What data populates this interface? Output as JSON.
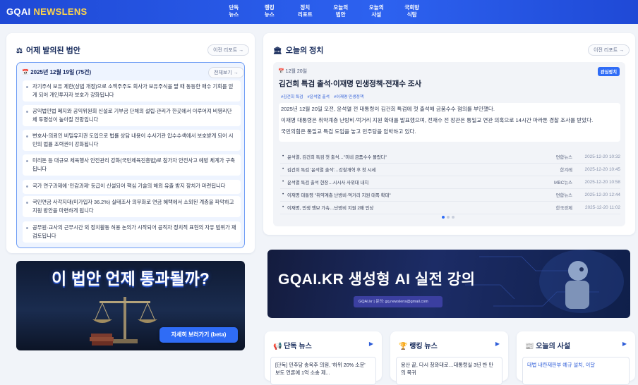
{
  "brand": {
    "part1": "GQAI",
    "part2": "NEWSLENS"
  },
  "nav": [
    {
      "label": "단독\n뉴스"
    },
    {
      "label": "랭킹\n뉴스"
    },
    {
      "label": "정치\n리포트"
    },
    {
      "label": "오늘의\n법안"
    },
    {
      "label": "오늘의\n사설"
    },
    {
      "label": "국회방\n식탐"
    }
  ],
  "law_section": {
    "title": "어제 발의된 법안",
    "prev_report": "이전 리포트 →",
    "date": "2025년 12월 19일 (75건)",
    "view_all": "전체보기 →",
    "items": [
      "자기주식 보유 제한(상법 개정)으로 소액주주도 회사가 보유주식을 팔 때 동등한 매수 기회를 얻게 되어 개인투자자 보호가 강화됩니다",
      "공익법인법 폐지와 공익위원회 신설로 기부금 단체의 설립·관리가 한곳에서 이루어져 비영리단체 투명성이 높아질 전망입니다",
      "변호사-의뢰인 비밀유지권 도입으로 법률 상담 내용이 수사기관 압수수색에서 보호받게 되어 시민의 법률 조력권이 강화됩니다",
      "미리돈 등 대규모 체육행사 안전관리 강화(국민체육진흥법)로 참가자 안전사고 예방 체계가 구축됩니다",
      "국가 연구과제에 '민감과제' 등급이 신설되어 핵심 기술의 해외 유출 방지 장치가 마련됩니다",
      "국민연금 사각지대(미가입자 36.2%) 실태조사 의무화로 연금 혜택에서 소외된 계층을 파악하고 지원 방안을 마련하게 됩니다",
      "공무원·교사의 근무시간 외 정치활동 허용 논의가 시작되어 공직자 정치적 표현의 자유 범위가 재검토됩니다"
    ]
  },
  "banner_law": {
    "title": "이 법안 언제 통과될까?",
    "cta": "자세히 보러가기 (beta)"
  },
  "politics": {
    "title": "오늘의 정치",
    "prev_report": "이전 리포트 →",
    "date": "12월 20일",
    "badge": "관심정치",
    "headline": "김건희 특검 출석·이재명 민생정책·전재수 조사",
    "tags": [
      "#김건희 특검",
      "#윤석열 출석",
      "#이재명 민생정책"
    ],
    "body": [
      "2025년 12월 20일 오전, 윤석열 전 대통령이 김건희 특검에 첫 출석해 금품수수 혐의를 부인했다.",
      "이재명 대통령은 취약계층 난방비·먹거리 지원 확대를 발표했으며, 전재수 전 장관은 통일교 연관 의혹으로 14시간 마라톤 경찰 조사를 받았다.",
      "국민의힘은 통일교 특검 도입을 놓고 민주당을 압박하고 있다."
    ],
    "news": [
      {
        "title": "윤석열, 김건희 특검 첫 출석…\"미네 금품수수 몰랐다\"",
        "source": "연합뉴스",
        "date": "2025-12-20 10:32"
      },
      {
        "title": "김건희 특검 '윤석열 출석'…강찰개혁 후 첫 시세",
        "source": "한겨레",
        "date": "2025-12-20 10:45"
      },
      {
        "title": "윤석열 특검 출석 현장…시시사 사위대 내지",
        "source": "MBC뉴스",
        "date": "2025-12-20 10:58"
      },
      {
        "title": "이재명 대통령 \"취약계층 난방비·먹거리 지원 대폭 확대\"",
        "source": "연합뉴스",
        "date": "2025-12-20 12:44"
      },
      {
        "title": "이재명, 민생 행보 가속…난방비 지원 2배 인상",
        "source": "한국경제",
        "date": "2025-12-20 11:02"
      }
    ]
  },
  "banner_ai": {
    "title": "GQAI.KR 생성형 AI 실전 강의",
    "sub": "GQAI.kr | 문의: gq.newslens@gmail.com"
  },
  "bottom_cards": [
    {
      "title": "단독 뉴스",
      "item": "[단독] 민주당 송옥주 의원, '하위 20% 소문' 보도 언론에 1억 소송 제..."
    },
    {
      "title": "랭킹 뉴스",
      "item": "용산 끝, 다시 청와대로…대통령실 3년 반 만의 복귀"
    },
    {
      "title": "오늘의 사설",
      "item": "대법 내란재판부 예규 설치, 이달"
    }
  ]
}
